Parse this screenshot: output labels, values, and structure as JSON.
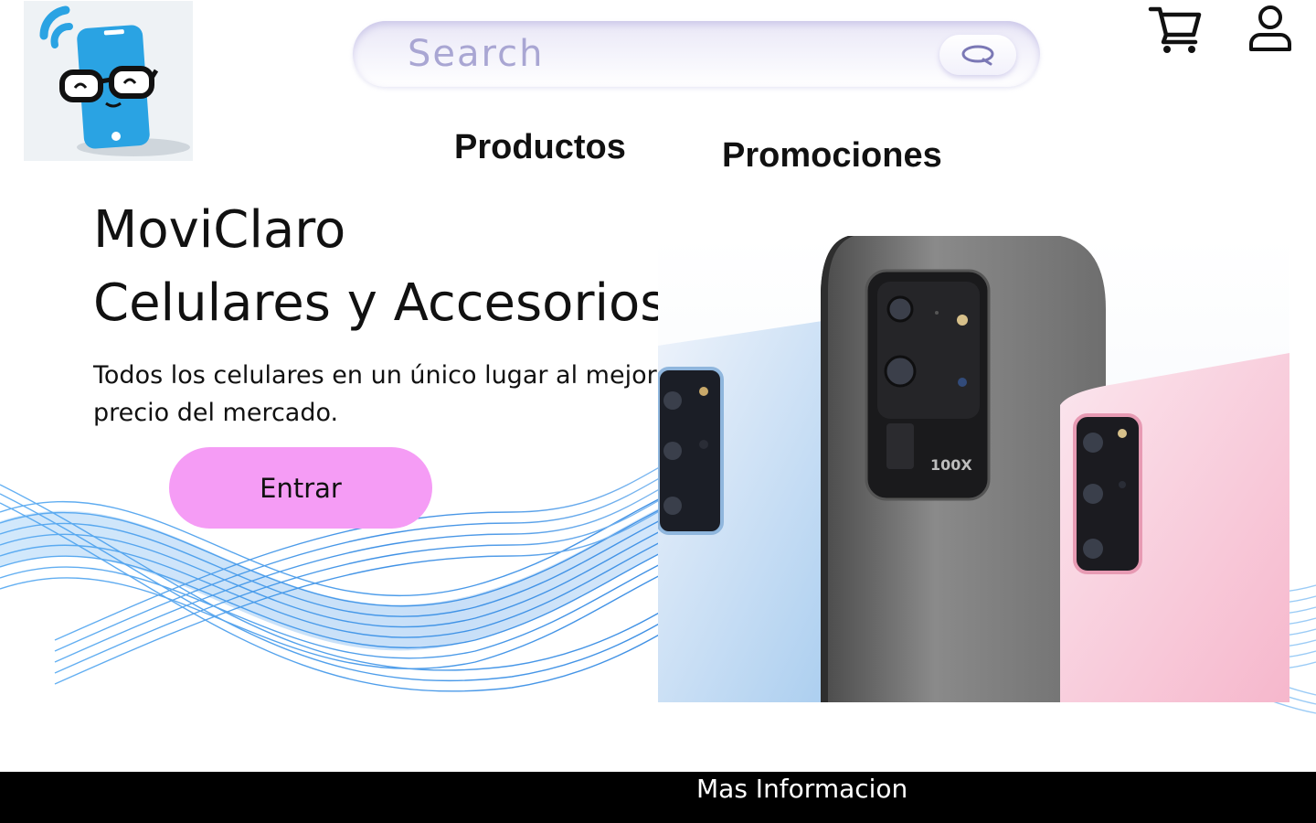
{
  "header": {
    "logo_icon": "smartphone-with-glasses-logo",
    "search": {
      "placeholder": "Search",
      "icon": "search-icon"
    },
    "cart_icon": "cart-icon",
    "user_icon": "user-icon"
  },
  "nav": {
    "items": [
      {
        "label": "Productos"
      },
      {
        "label": "Promociones"
      }
    ]
  },
  "hero": {
    "title_line1": "MoviClaro",
    "title_line2": "Celulares y Accesorios",
    "description": "Todos los celulares en un único lugar al mejor precio del mercado.",
    "cta_label": "Entrar",
    "cta_color": "#f59cf5",
    "phone_label": "100X"
  },
  "footer": {
    "link_label": "Mas Informacion",
    "background": "#000000"
  }
}
